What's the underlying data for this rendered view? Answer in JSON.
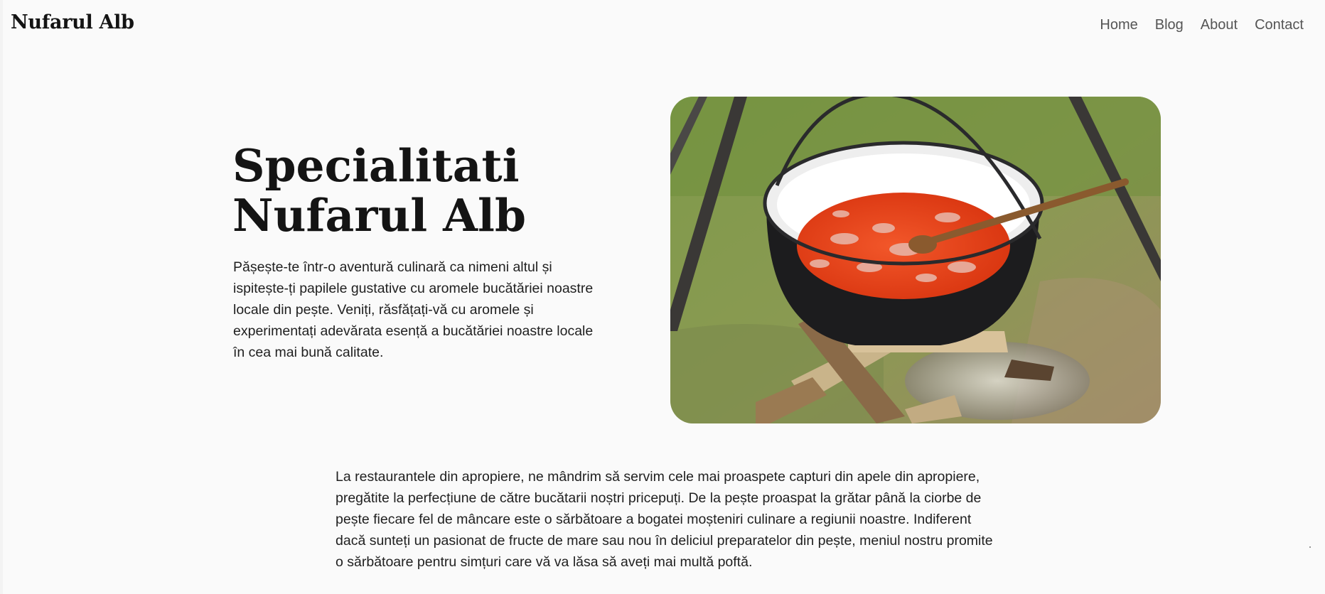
{
  "header": {
    "brand": "Nufarul Alb",
    "nav": [
      {
        "label": "Home"
      },
      {
        "label": "Blog"
      },
      {
        "label": "About"
      },
      {
        "label": "Contact"
      }
    ]
  },
  "hero": {
    "title_line1": "Specialitati",
    "title_line2": "Nufarul Alb",
    "text": "Pășește-te într-o aventură culinară ca nimeni altul și ispitește-ți papilele gustative cu aromele bucătăriei noastre locale din pește. Veniți, răsfățați-vă cu aromele și experimentați adevărata esență a bucătăriei noastre locale în cea mai bună calitate.",
    "image_icon": "fish-soup-cauldron-photo"
  },
  "intro": {
    "text": "La restaurantele din apropiere, ne mândrim să servim cele mai proaspete capturi din apele din apropiere, pregătite la perfecțiune de către bucătarii noștri pricepuți. De la pește proaspat la grătar până la ciorbe de pește fiecare fel de mâncare este o sărbătoare a bogatei moșteniri culinare a regiunii noastre. Indiferent dacă sunteți un pasionat de fructe de mare sau nou în deliciul preparatelor din pește, meniul nostru promite o sărbătoare pentru simțuri care vă va lăsa să aveți mai multă poftă."
  },
  "colors": {
    "background": "#fafafa",
    "text": "#141414",
    "nav_text": "#555555",
    "soup": "#e8401a"
  }
}
